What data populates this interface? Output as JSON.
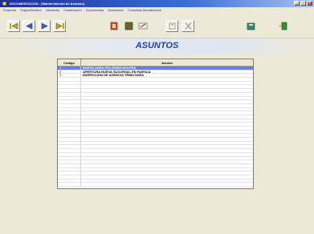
{
  "window": {
    "title": "DOCUMENTACION - [Mantenimiento de Asuntos]",
    "buttons": [
      "_",
      "▫",
      "×"
    ]
  },
  "menu": [
    "Empresa",
    "Origen/Destino",
    "Ubicación",
    "Clasificación",
    "Documentos",
    "Accesorios",
    "Consultas Actualización"
  ],
  "toolbar": {
    "buttons": [
      {
        "name": "first-record-button",
        "icon": "first-icon"
      },
      {
        "name": "prev-record-button",
        "icon": "prev-icon"
      },
      {
        "name": "next-record-button",
        "icon": "next-icon"
      },
      {
        "name": "last-record-button",
        "icon": "last-icon"
      },
      {
        "name": "new-button",
        "icon": "new-record-icon"
      },
      {
        "name": "delete-button",
        "icon": "delete-icon"
      },
      {
        "name": "edit-button",
        "icon": "edit-icon"
      },
      {
        "name": "save-button",
        "icon": "save-icon"
      },
      {
        "name": "cancel-button",
        "icon": "cancel-icon"
      },
      {
        "name": "print-button",
        "icon": "print-icon"
      },
      {
        "name": "exit-button",
        "icon": "exit-icon"
      }
    ]
  },
  "header": {
    "title": "ASUNTOS"
  },
  "grid": {
    "columns": [
      "Código",
      "Asunto"
    ],
    "rows": [
      {
        "code": "1",
        "subject": "NUEVA LINEA POLIZONS INSLPEA",
        "selected": true
      },
      {
        "code": "2",
        "subject": "APERTURA NUEVA SUCURSAL EN HUESCA",
        "selected": false
      },
      {
        "code": "3",
        "subject": "INSPECCION DE AGENCIA TRIBUTARIA",
        "selected": false
      }
    ],
    "empty_rows": 29
  },
  "colors": {
    "header_text": "#2040c0",
    "selected_row": "#6b7fe0",
    "titlebar": "#1c2f9a"
  }
}
